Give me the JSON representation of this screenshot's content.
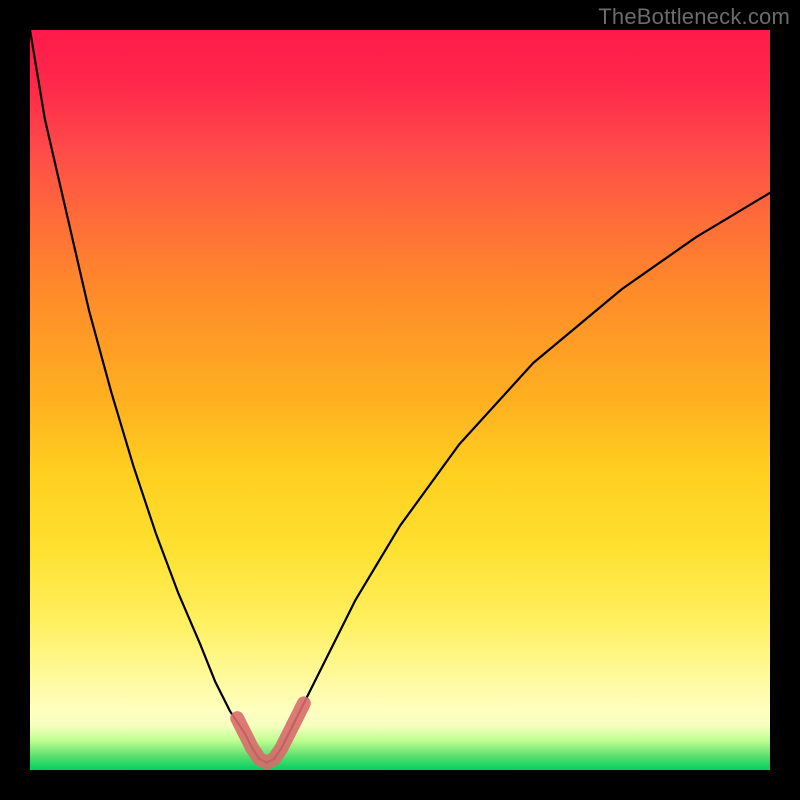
{
  "watermark": "TheBottleneck.com",
  "chart_data": {
    "type": "line",
    "title": "",
    "xlabel": "",
    "ylabel": "",
    "xlim": [
      0,
      1
    ],
    "ylim": [
      0,
      1
    ],
    "annotations": [
      "TheBottleneck.com"
    ],
    "series": [
      {
        "name": "bottleneck-curve",
        "x": [
          0.0,
          0.02,
          0.05,
          0.08,
          0.11,
          0.14,
          0.17,
          0.2,
          0.23,
          0.25,
          0.27,
          0.29,
          0.3,
          0.31,
          0.32,
          0.33,
          0.34,
          0.35,
          0.37,
          0.4,
          0.44,
          0.5,
          0.58,
          0.68,
          0.8,
          0.9,
          1.0
        ],
        "y": [
          1.0,
          0.88,
          0.75,
          0.62,
          0.51,
          0.41,
          0.32,
          0.24,
          0.17,
          0.12,
          0.08,
          0.05,
          0.03,
          0.015,
          0.01,
          0.015,
          0.03,
          0.05,
          0.09,
          0.15,
          0.23,
          0.33,
          0.44,
          0.55,
          0.65,
          0.72,
          0.78
        ]
      },
      {
        "name": "minimum-highlight",
        "x": [
          0.28,
          0.29,
          0.3,
          0.31,
          0.32,
          0.33,
          0.34,
          0.35,
          0.36,
          0.37
        ],
        "y": [
          0.07,
          0.05,
          0.03,
          0.015,
          0.01,
          0.015,
          0.03,
          0.05,
          0.07,
          0.09
        ]
      }
    ],
    "gradient_stops": [
      {
        "pos": 0.0,
        "color": "#ff1a4a"
      },
      {
        "pos": 0.5,
        "color": "#ffb020"
      },
      {
        "pos": 0.88,
        "color": "#fffaa0"
      },
      {
        "pos": 1.0,
        "color": "#00d060"
      }
    ],
    "minimum_x": 0.325
  }
}
